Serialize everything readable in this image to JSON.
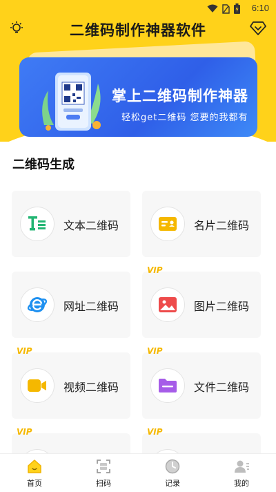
{
  "status": {
    "time": "6:10"
  },
  "header": {
    "title": "二维码制作神器软件"
  },
  "banner": {
    "title": "掌上二维码制作神器",
    "subtitle": "轻松get二维码   您要的我都有"
  },
  "section": {
    "title": "二维码生成"
  },
  "cards": [
    {
      "label": "文本二维码",
      "icon": "text-icon",
      "vip": false
    },
    {
      "label": "名片二维码",
      "icon": "business-card-icon",
      "vip": false
    },
    {
      "label": "网址二维码",
      "icon": "browser-icon",
      "vip": false
    },
    {
      "label": "图片二维码",
      "icon": "image-icon",
      "vip": true
    },
    {
      "label": "视频二维码",
      "icon": "video-icon",
      "vip": true
    },
    {
      "label": "文件二维码",
      "icon": "folder-icon",
      "vip": true
    },
    {
      "label": "",
      "icon": "",
      "vip": true
    },
    {
      "label": "",
      "icon": "",
      "vip": true
    }
  ],
  "vip_tag_text": "VIP",
  "nav": [
    {
      "label": "首页",
      "icon": "home-icon",
      "active": true
    },
    {
      "label": "扫码",
      "icon": "scan-icon",
      "active": false
    },
    {
      "label": "记录",
      "icon": "history-icon",
      "active": false
    },
    {
      "label": "我的",
      "icon": "profile-icon",
      "active": false
    }
  ],
  "colors": {
    "accent": "#FFD21A",
    "banner_blue": "#3467EE",
    "text_green": "#22B573",
    "vip_gold": "#F5B800"
  }
}
